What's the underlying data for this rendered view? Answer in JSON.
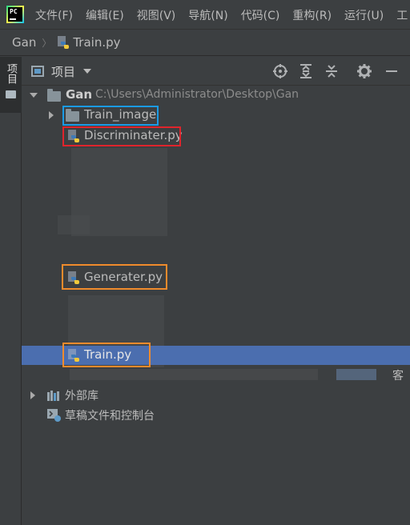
{
  "app": {
    "logo_text": "PC"
  },
  "menu": [
    "文件(F)",
    "编辑(E)",
    "视图(V)",
    "导航(N)",
    "代码(C)",
    "重构(R)",
    "运行(U)",
    "工"
  ],
  "breadcrumb": {
    "project": "Gan",
    "file": "Train.py"
  },
  "tool_strip": {
    "tab_label": "项目"
  },
  "panel": {
    "title": "项目",
    "toolbar": [
      "locate-icon",
      "expand-all-icon",
      "collapse-all-icon",
      "gear-icon",
      "minimize-icon"
    ]
  },
  "tree": {
    "root": {
      "name": "Gan",
      "path": "C:\\Users\\Administrator\\Desktop\\Gan"
    },
    "folder_train_image": "Train_image",
    "file_discriminater": "Discriminater.py",
    "file_generater": "Generater.py",
    "file_train": "Train.py",
    "partial_row_right": "客",
    "external_libs": "外部库",
    "scratches": "草稿文件和控制台"
  },
  "colors": {
    "background": "#3c3f41",
    "selection": "#4b6eaf",
    "highlight_blue": "#1a9be6",
    "highlight_red": "#e0242c",
    "highlight_orange": "#f08b2c"
  }
}
